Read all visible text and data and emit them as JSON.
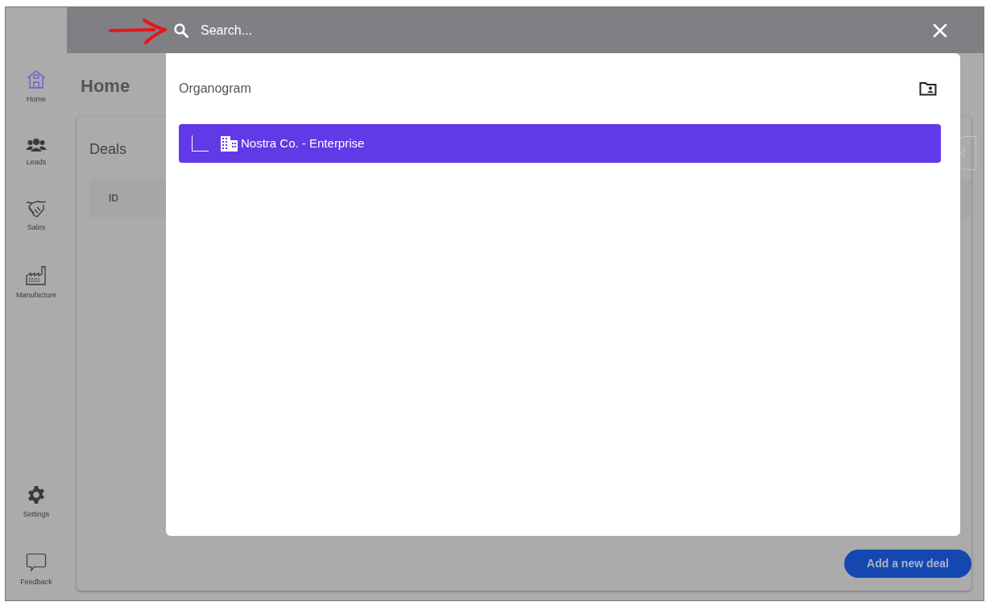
{
  "search": {
    "placeholder": "Search..."
  },
  "sidebar": {
    "items": [
      {
        "label": "Home",
        "selected": true
      },
      {
        "label": "Leads",
        "selected": false
      },
      {
        "label": "Sales",
        "selected": false
      },
      {
        "label": "Manufacture",
        "selected": false
      }
    ],
    "bottom_items": [
      {
        "label": "Settings"
      },
      {
        "label": "Feedback"
      }
    ]
  },
  "page_title": "Home",
  "deals": {
    "title": "Deals",
    "columns": [
      "ID"
    ],
    "add_button": "Add a new deal"
  },
  "modal": {
    "title": "Organogram",
    "tree": [
      {
        "label": "Nostra Co. - Enterprise",
        "selected": true
      }
    ]
  }
}
